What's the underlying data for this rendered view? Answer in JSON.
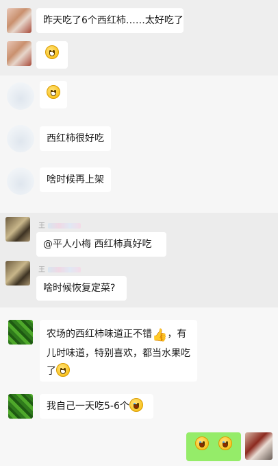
{
  "messages": [
    {
      "text": "昨天吃了6个西红柿……太好吃了"
    },
    {
      "emoji": "thinking-face-icon"
    },
    {
      "emoji": "grin-face-icon"
    },
    {
      "text": "西红柿很好吃"
    },
    {
      "text": "啥时候再上架"
    },
    {
      "sender": "王",
      "text": "@平人小梅  西红柿真好吃"
    },
    {
      "sender": "王",
      "text": "啥时候恢复定菜?"
    },
    {
      "line1": "农场的西红柿味道正不错",
      "line1b": "，有",
      "line2": "儿时味道，特别喜欢，都当水果吃",
      "line3": "了"
    },
    {
      "text": "我自己一天吃5-6个"
    },
    {
      "emoji": "laugh-cry-icon"
    }
  ]
}
